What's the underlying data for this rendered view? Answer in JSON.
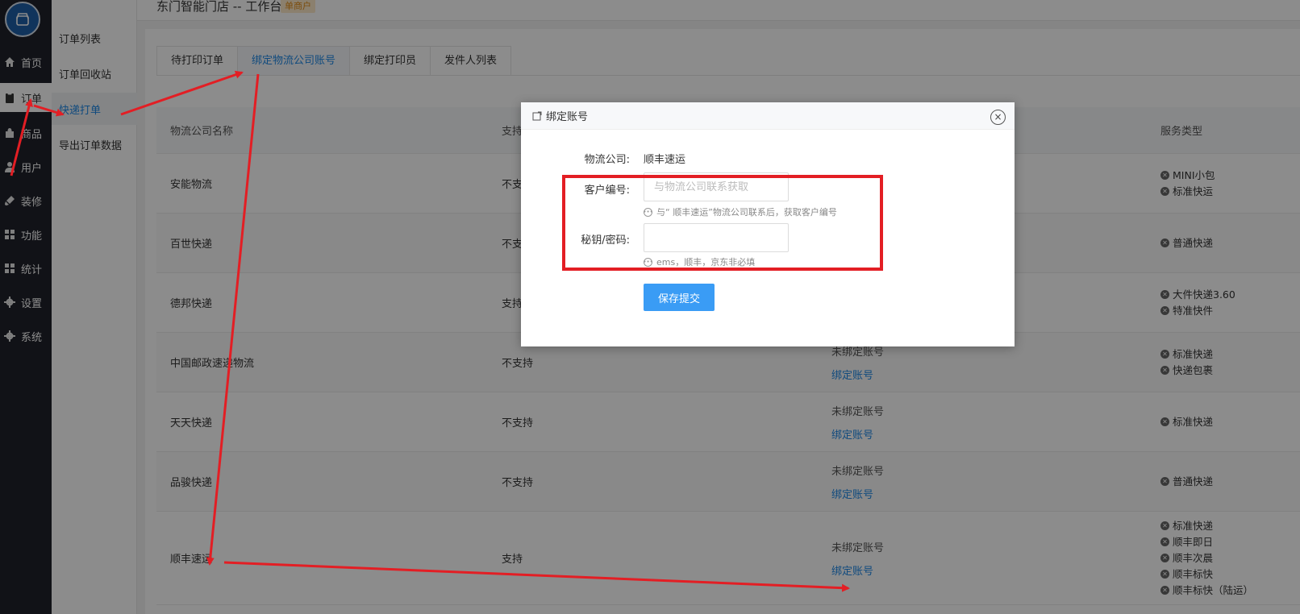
{
  "header": {
    "title": "东门智能门店 -- 工作台",
    "badge": "单商户"
  },
  "nav": {
    "items": [
      {
        "label": "首页",
        "icon": "home-icon"
      },
      {
        "label": "订单",
        "icon": "clipboard-icon"
      },
      {
        "label": "商品",
        "icon": "bag-icon"
      },
      {
        "label": "用户",
        "icon": "user-icon"
      },
      {
        "label": "装修",
        "icon": "brush-icon"
      },
      {
        "label": "功能",
        "icon": "grid-icon"
      },
      {
        "label": "统计",
        "icon": "grid-icon"
      },
      {
        "label": "设置",
        "icon": "gear-icon"
      },
      {
        "label": "系统",
        "icon": "gear-icon"
      }
    ]
  },
  "subnav": {
    "items": [
      "订单列表",
      "订单回收站",
      "快递打单",
      "导出订单数据"
    ]
  },
  "tabs": [
    "待打印订单",
    "绑定物流公司账号",
    "绑定打印员",
    "发件人列表"
  ],
  "table": {
    "headers": [
      "物流公司名称",
      "支持",
      "",
      "服务类型"
    ],
    "rows": [
      {
        "name": "安能物流",
        "support": "不支持",
        "status": "",
        "link": "",
        "services": [
          "MINI小包",
          "标准快运"
        ]
      },
      {
        "name": "百世快递",
        "support": "不支持",
        "status": "",
        "link": "",
        "services": [
          "普通快递"
        ]
      },
      {
        "name": "德邦快递",
        "support": "支持",
        "status": "",
        "link": "",
        "services": [
          "大件快递3.60",
          "特准快件"
        ]
      },
      {
        "name": "中国邮政速递物流",
        "support": "不支持",
        "status": "未绑定账号",
        "link": "绑定账号",
        "services": [
          "标准快递",
          "快递包裹"
        ]
      },
      {
        "name": "天天快递",
        "support": "不支持",
        "status": "未绑定账号",
        "link": "绑定账号",
        "services": [
          "标准快递"
        ]
      },
      {
        "name": "品骏快递",
        "support": "不支持",
        "status": "未绑定账号",
        "link": "绑定账号",
        "services": [
          "普通快递"
        ]
      },
      {
        "name": "顺丰速运",
        "support": "支持",
        "status": "未绑定账号",
        "link": "绑定账号",
        "services": [
          "标准快递",
          "顺丰即日",
          "顺丰次晨",
          "顺丰标快",
          "顺丰标快（陆运）"
        ]
      }
    ]
  },
  "dialog": {
    "title": "绑定账号",
    "company_label": "物流公司:",
    "company_value": "顺丰速运",
    "customer_label": "客户编号:",
    "customer_placeholder": "与物流公司联系获取",
    "customer_hint": "与“ 顺丰速运”物流公司联系后，获取客户编号",
    "secret_label": "秘钥/密码:",
    "secret_hint": "ems，顺丰，京东非必填",
    "submit_label": "保存提交",
    "close_symbol": "×"
  },
  "colors": {
    "accent": "#1e88e5",
    "button": "#3a9cf5",
    "annotation": "#e31e24",
    "nav_bg": "#20222a"
  }
}
